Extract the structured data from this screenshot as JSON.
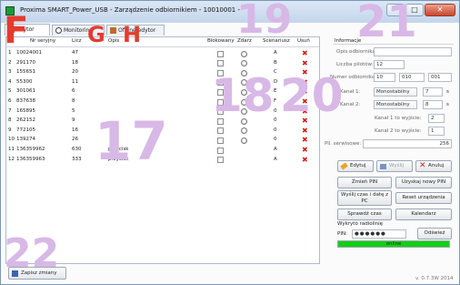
{
  "window": {
    "title": "Proxima SMART_Power_USB - Zarządzenie odbiornikiem - 10010001 -",
    "controls": [
      "–",
      "□",
      "✕"
    ]
  },
  "tabs": [
    {
      "label": "Edytor"
    },
    {
      "label": "Monitoring"
    },
    {
      "label": "Offline edytor"
    }
  ],
  "table": {
    "headers": [
      "P",
      "Nr seryjny",
      "Licz",
      "Opis",
      "Blokowany",
      "Zdarz",
      "Scenariusz",
      "Usuń"
    ],
    "rows": [
      {
        "p": "1",
        "serial": "10024001",
        "count": "47",
        "desc": "",
        "scen": "A",
        "has_radio": true
      },
      {
        "p": "2",
        "serial": "291170",
        "count": "18",
        "desc": "",
        "scen": "B",
        "has_radio": true
      },
      {
        "p": "3",
        "serial": "155651",
        "count": "20",
        "desc": "",
        "scen": "C",
        "has_radio": true
      },
      {
        "p": "4",
        "serial": "55300",
        "count": "11",
        "desc": "",
        "scen": "D",
        "has_radio": true
      },
      {
        "p": "5",
        "serial": "301061",
        "count": "6",
        "desc": "",
        "scen": "E",
        "has_radio": true
      },
      {
        "p": "6",
        "serial": "837638",
        "count": "8",
        "desc": "",
        "scen": "F",
        "has_radio": true
      },
      {
        "p": "7",
        "serial": "165895",
        "count": "5",
        "desc": "",
        "scen": "0",
        "has_radio": true
      },
      {
        "p": "8",
        "serial": "262152",
        "count": "9",
        "desc": "",
        "scen": "0",
        "has_radio": true
      },
      {
        "p": "9",
        "serial": "772105",
        "count": "16",
        "desc": "",
        "scen": "0",
        "has_radio": true
      },
      {
        "p": "10",
        "serial": "139274",
        "count": "26",
        "desc": "",
        "scen": "0",
        "has_radio": true
      },
      {
        "p": "11",
        "serial": "136359962",
        "count": "630",
        "desc": "przycisk",
        "scen": "A",
        "has_radio": false
      },
      {
        "p": "12",
        "serial": "136359963",
        "count": "333",
        "desc": "przycisk",
        "scen": "A",
        "has_radio": false
      }
    ]
  },
  "save_button": "Zapisz zmiany",
  "panel": {
    "section": "Informacje",
    "opis_label": "Opis odbiornika:",
    "liczba_label": "Liczba pilotów:",
    "liczba_value": "12",
    "numer_label": "Numer odbiornika:",
    "numer_values": [
      "10",
      "010",
      "001"
    ],
    "kanal1_label": "Kanał 1:",
    "kanal1_mode": "Monostabilny",
    "kanal1_value": "7",
    "kanal2_label": "Kanał 2:",
    "kanal2_mode": "Monostabilny",
    "kanal2_value": "8",
    "unit": "s",
    "kanal1_wyjscie": "Kanał 1 to wyjście:",
    "kanal1_wyjscie_val": "2",
    "kanal2_wyjscie": "Kanał 2 to wyjście:",
    "kanal2_wyjscie_val": "1",
    "pil_label": "Pil. serwisowe:",
    "pil_value": "256",
    "edit": "Edytuj",
    "send": "Wyślij",
    "cancel": "Anuluj",
    "change_pin": "Zmień PIN",
    "get_pin": "Uzyskaj nowy PIN",
    "send_time": "Wyślij czas i datę z PC",
    "reset": "Reset urządzenia",
    "check_time": "Sprawdź czas",
    "calendar": "Kalendarz",
    "radio_label": "Wykryto radiolinię",
    "pin_label": "PIN:",
    "pin_value": "●●●●●●",
    "refresh": "Odśwież",
    "status": "online",
    "status_progress": 1.0
  },
  "version": "v. 0.7.3W 2014",
  "annotations": [
    "19",
    "21",
    "F",
    "G",
    "H",
    "18",
    "20",
    "17",
    "22"
  ],
  "colors": {
    "annotation": "#d8b8e6",
    "accent": "#11d011",
    "delete": "#d32020"
  }
}
